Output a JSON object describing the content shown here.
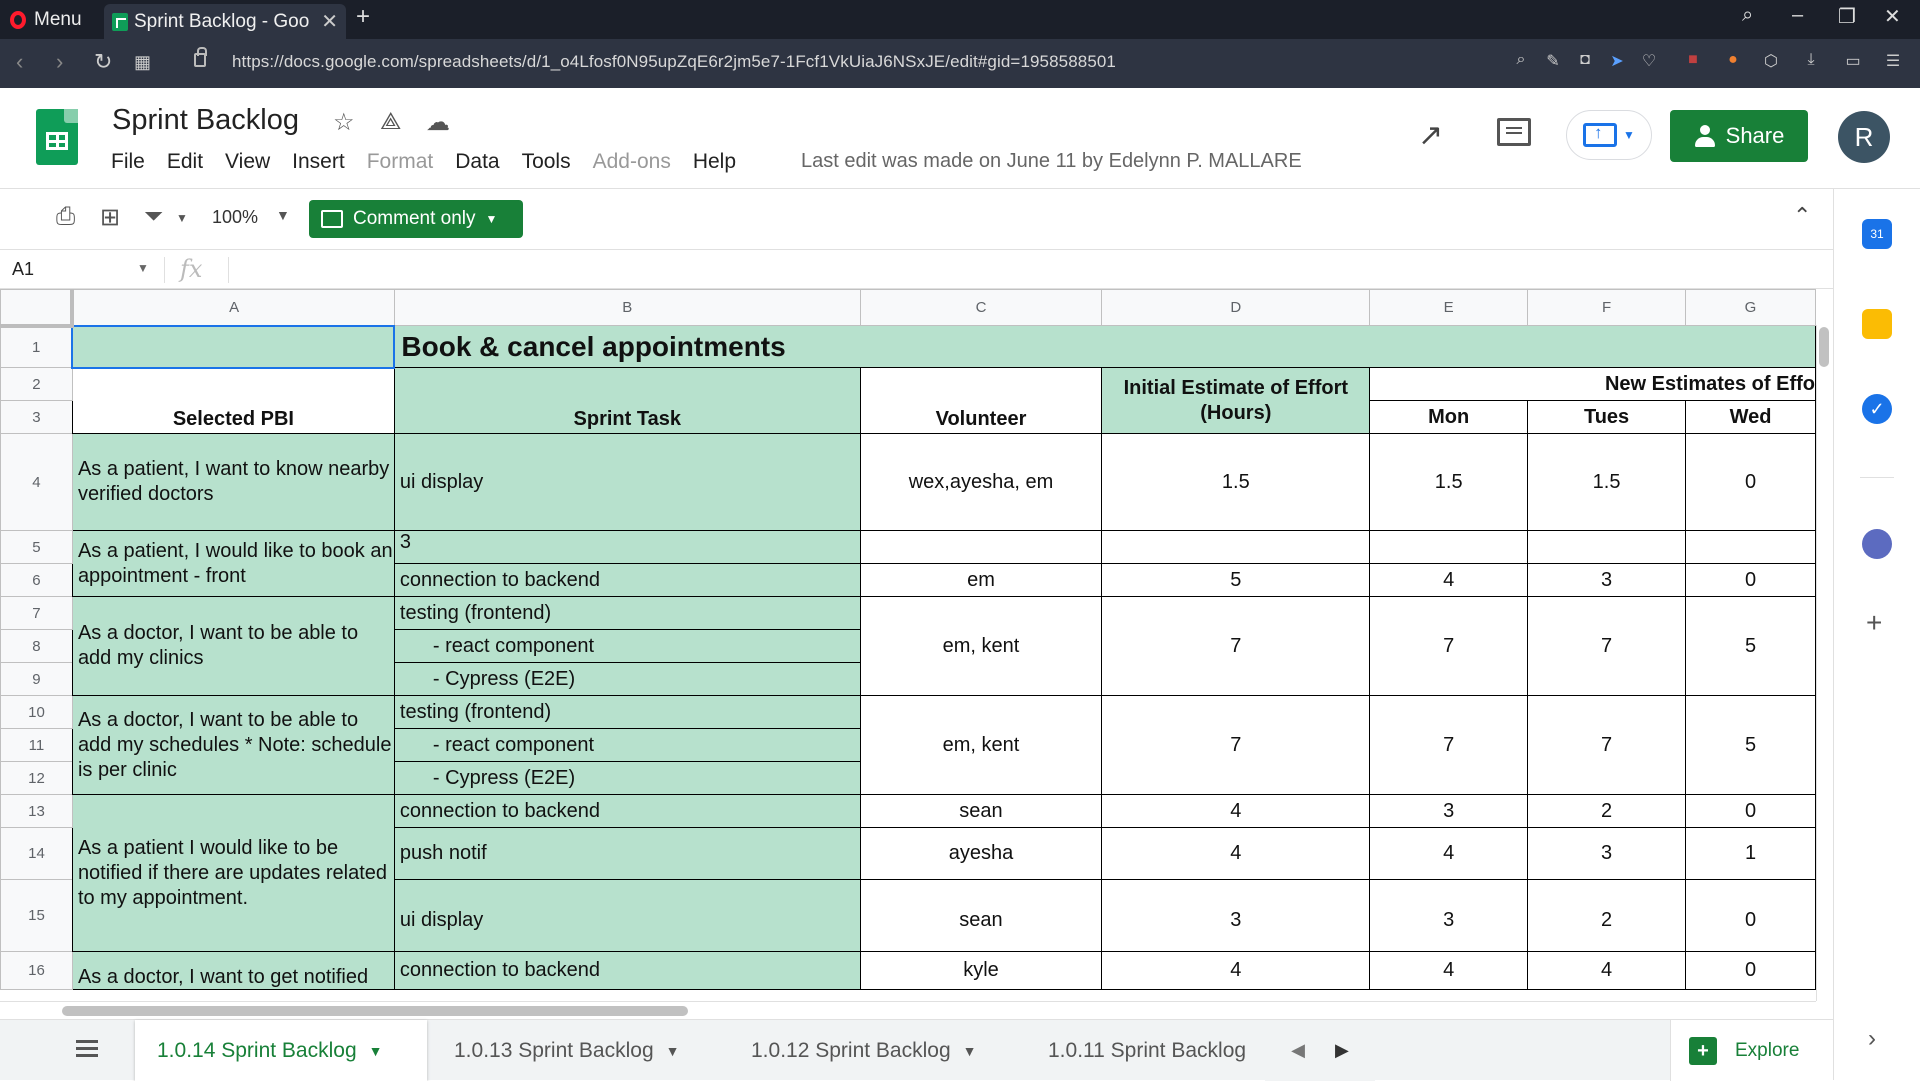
{
  "browser": {
    "menu_label": "Menu",
    "tab_title": "Sprint Backlog - Goo",
    "url": "https://docs.google.com/spreadsheets/d/1_o4Lfosf0N95upZqE6r2jm5e7-1Fcf1VkUiaJ6NSxJE/edit#gid=1958588501"
  },
  "doc": {
    "title": "Sprint Backlog",
    "menu": [
      "File",
      "Edit",
      "View",
      "Insert",
      "Format",
      "Data",
      "Tools",
      "Add-ons",
      "Help"
    ],
    "last_edit": "Last edit was made on June 11 by Edelynn P. MALLARE",
    "share_label": "Share",
    "avatar_letter": "R"
  },
  "toolbar": {
    "zoom": "100%",
    "mode_label": "Comment only"
  },
  "formula_bar": {
    "cell_ref": "A1",
    "fx": "fx"
  },
  "grid": {
    "columns": [
      "A",
      "B",
      "C",
      "D",
      "E",
      "F",
      "G"
    ],
    "rows": [
      "1",
      "2",
      "3",
      "4",
      "5",
      "6",
      "7",
      "8",
      "9",
      "10",
      "11",
      "12",
      "13",
      "14",
      "15",
      "16"
    ],
    "title": "Book & cancel appointments",
    "headers": {
      "selected_pbi": "Selected PBI",
      "sprint_task": "Sprint Task",
      "volunteer": "Volunteer",
      "initial_estimate": "Initial Estimate of Effort (Hours)",
      "new_estimates": "New Estimates of Effo",
      "mon": "Mon",
      "tues": "Tues",
      "wed": "Wed"
    },
    "pbi": [
      "As a patient, I want to know nearby verified doctors",
      "As a patient, I would like to book an appointment - front",
      "As a doctor, I want to be able to add my clinics",
      "As a doctor, I want to be able to add my schedules * Note: schedule is per clinic",
      "As a patient I would like to be notified if there are updates related to my appointment.",
      "As a doctor, I want to get notified"
    ],
    "r4": {
      "task": "ui display",
      "vol": "wex,ayesha, em",
      "est": "1.5",
      "mon": "1.5",
      "tue": "1.5",
      "wed": "0"
    },
    "r5": {
      "task": "3"
    },
    "r6": {
      "task": "connection to backend",
      "vol": "em",
      "est": "5",
      "mon": "4",
      "tue": "3",
      "wed": "0"
    },
    "r7": {
      "task": "testing (frontend)"
    },
    "r8": {
      "task": "- react component",
      "vol": "em, kent",
      "est": "7",
      "mon": "7",
      "tue": "7",
      "wed": "5"
    },
    "r9": {
      "task": "- Cypress (E2E)"
    },
    "r10": {
      "task": "testing (frontend)"
    },
    "r11": {
      "task": "- react component",
      "vol": "em, kent",
      "est": "7",
      "mon": "7",
      "tue": "7",
      "wed": "5"
    },
    "r12": {
      "task": "- Cypress (E2E)"
    },
    "r13": {
      "task": "connection to backend",
      "vol": "sean",
      "est": "4",
      "mon": "3",
      "tue": "2",
      "wed": "0"
    },
    "r14": {
      "task": "push notif",
      "vol": "ayesha",
      "est": "4",
      "mon": "4",
      "tue": "3",
      "wed": "1"
    },
    "r15": {
      "task": "ui display",
      "vol": "sean",
      "est": "3",
      "mon": "3",
      "tue": "2",
      "wed": "0"
    },
    "r16": {
      "task": "connection to backend",
      "vol": "kyle",
      "est": "4",
      "mon": "4",
      "tue": "4",
      "wed": "0"
    }
  },
  "sheets": {
    "tabs": [
      "1.0.14 Sprint Backlog",
      "1.0.13 Sprint Backlog",
      "1.0.12 Sprint Backlog",
      "1.0.11 Sprint Backlog"
    ],
    "explore_label": "Explore"
  },
  "colors": {
    "header_green": "#b7e1cd",
    "accent_green": "#188038",
    "selection_blue": "#1a73e8"
  }
}
